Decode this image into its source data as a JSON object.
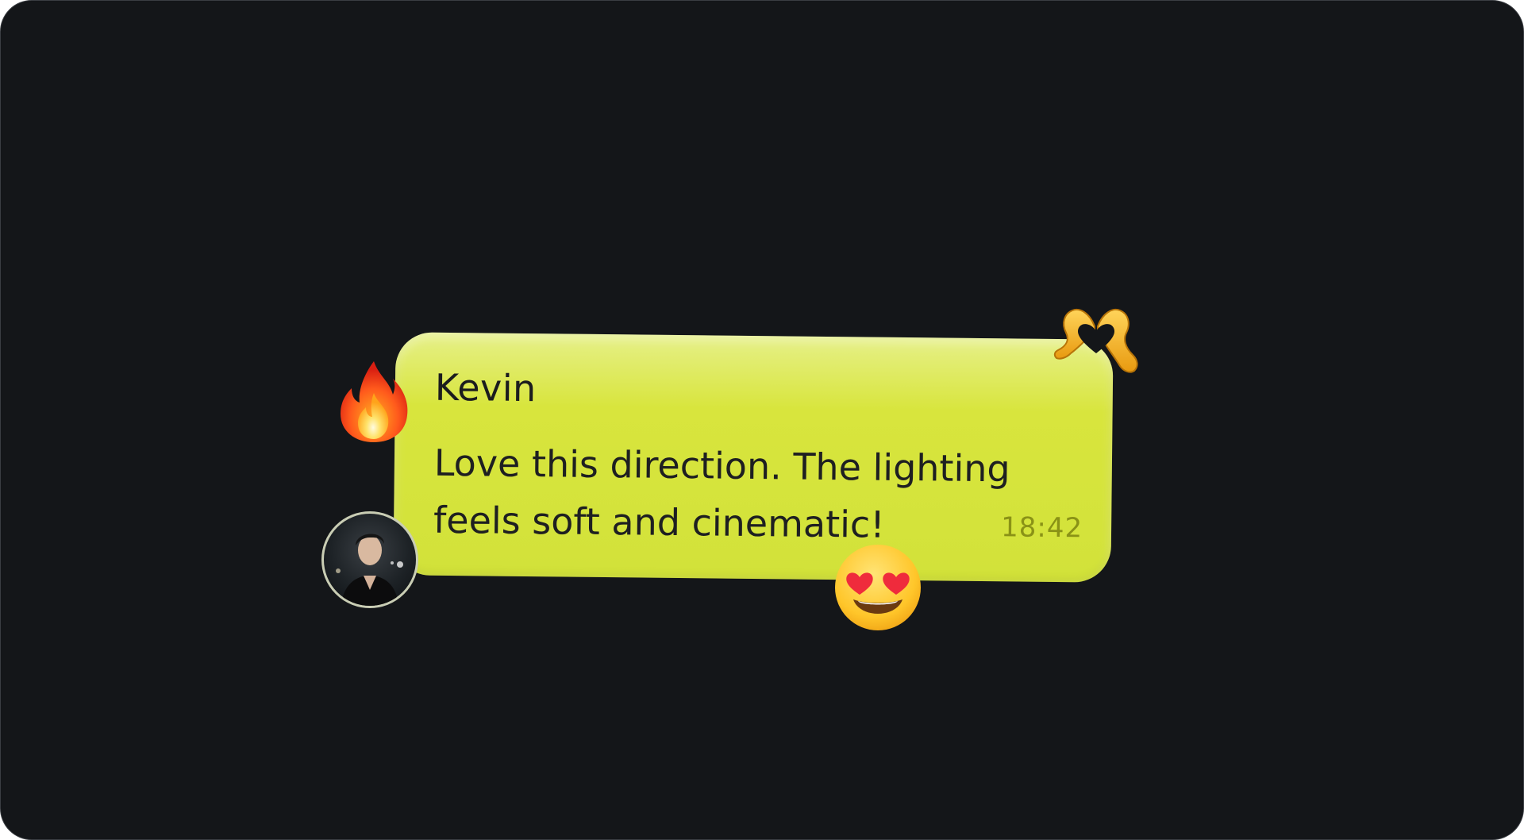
{
  "message": {
    "sender": "Kevin",
    "text": "Love this direction. The lighting feels soft and cinematic!",
    "time": "18:42",
    "bubble_color": "#d6e43c"
  },
  "reactions": [
    {
      "icon": "fire-emoji-icon"
    },
    {
      "icon": "heart-hands-emoji-icon"
    },
    {
      "icon": "heart-eyes-emoji-icon"
    }
  ],
  "avatar": {
    "icon": "avatar"
  },
  "colors": {
    "background": "#141619",
    "sender_text": "#1b1c1e",
    "time_text": "#8a9216"
  }
}
